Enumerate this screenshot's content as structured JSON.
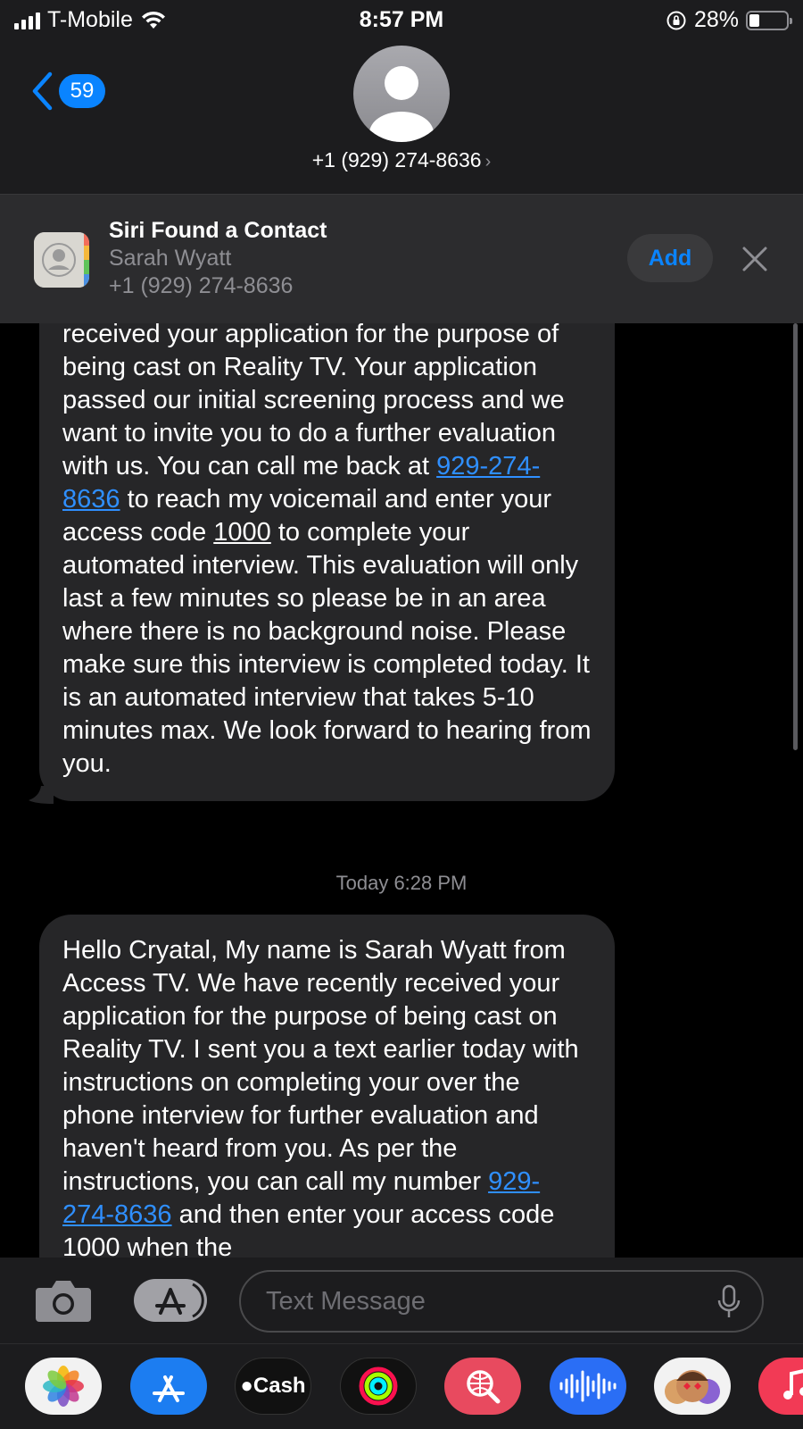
{
  "status": {
    "carrier": "T-Mobile",
    "time": "8:57 PM",
    "battery_percent": "28%",
    "battery_level": 0.28
  },
  "header": {
    "back_count": "59",
    "contact_number": "+1 (929) 274-8636"
  },
  "siri_banner": {
    "title": "Siri Found a Contact",
    "name": "Sarah Wyatt",
    "phone": "+1 (929) 274-8636",
    "add_label": "Add"
  },
  "messages": [
    {
      "parts": [
        "received your application for the purpose of being cast on Reality TV.  Your application passed our initial screening process and we want to invite you to do a further evaluation with us. You can call me back at ",
        "929-274-8636",
        " to reach my voicemail and enter your access code ",
        "1000",
        " to complete your automated interview.  This evaluation will only last a few minutes so please be in an area where there is no background noise. Please make sure this interview is completed today. It is an automated interview that takes 5-10 minutes max. We look forward to hearing from you."
      ]
    },
    {
      "timestamp": "Today 6:28 PM",
      "parts": [
        "Hello Cryatal, My name is Sarah Wyatt from Access TV. We have recently received your application for the purpose of being cast on Reality TV. I sent you a text earlier today with instructions on completing your over the phone interview for further evaluation and haven't heard from you. As per the instructions, you can call my number ",
        "929-274-8636",
        " and then enter your access code ",
        "1000",
        " when the"
      ]
    }
  ],
  "composer": {
    "placeholder": "Text Message"
  },
  "app_drawer": {
    "cash_label": "Cash",
    "apps": [
      "photos-app",
      "app-store-app",
      "apple-cash-app",
      "activity-app",
      "web-search-app",
      "voice-memo-app",
      "memoji-app",
      "music-app"
    ]
  }
}
